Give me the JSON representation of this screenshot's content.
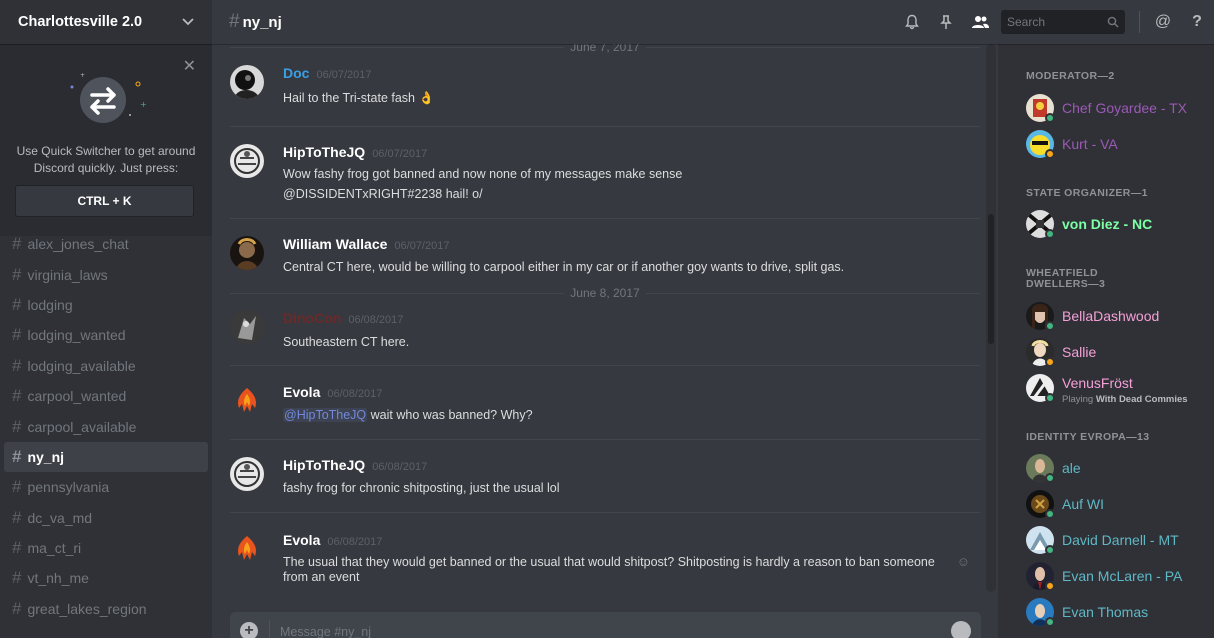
{
  "server": {
    "name": "Charlottesville 2.0"
  },
  "quick_switcher": {
    "text": "Use Quick Switcher to get around Discord quickly. Just press:",
    "shortcut": "CTRL + K"
  },
  "channels": [
    "alex_jones_chat",
    "virginia_laws",
    "lodging",
    "lodging_wanted",
    "lodging_available",
    "carpool_wanted",
    "carpool_available",
    "ny_nj",
    "pennsylvania",
    "dc_va_md",
    "ma_ct_ri",
    "vt_nh_me",
    "great_lakes_region"
  ],
  "active_channel": "ny_nj",
  "header": {
    "channel": "ny_nj",
    "search_placeholder": "Search"
  },
  "dividers": {
    "top": "June 7, 2017",
    "second": "June 8, 2017"
  },
  "messages": [
    {
      "author": "Doc",
      "color": "#3aa0e6",
      "date": "06/07/2017",
      "lines": [
        "Hail to the Tri-state fash 👌"
      ]
    },
    {
      "author": "HipToTheJQ",
      "color": "#ffffff",
      "date": "06/07/2017",
      "lines": [
        "Wow fashy frog got banned and now none of my messages make sense",
        "@DISSIDENTxRIGHT#2238 hail! o/"
      ]
    },
    {
      "author": "William Wallace",
      "color": "#ffffff",
      "date": "06/07/2017",
      "lines": [
        "Central CT here, would be willing to carpool either in my car or if another goy wants to drive, split gas."
      ]
    },
    {
      "author": "DinoCon",
      "color": "#6b2a2a",
      "date": "06/08/2017",
      "lines": [
        "Southeastern CT here."
      ]
    },
    {
      "author": "Evola",
      "color": "#ffffff",
      "date": "06/08/2017",
      "mention": "@HipToTheJQ",
      "lines": [
        "wait who was banned? Why?"
      ]
    },
    {
      "author": "HipToTheJQ",
      "color": "#ffffff",
      "date": "06/08/2017",
      "lines": [
        "fashy frog for chronic shitposting, just the usual lol"
      ]
    },
    {
      "author": "Evola",
      "color": "#ffffff",
      "date": "06/08/2017",
      "lines": [
        "The usual  that they would get banned or the usual that would shitpost? Shitposting is hardly a reason to ban someone",
        "from an event"
      ]
    }
  ],
  "composer": {
    "placeholder": "Message #ny_nj"
  },
  "members": {
    "groups": [
      {
        "title": "MODERATOR—2",
        "members": [
          {
            "name": "Chef Goyardee - TX",
            "color": "#9b59b6",
            "status": "#43b581"
          },
          {
            "name": "Kurt - VA",
            "color": "#9b59b6",
            "status": "#faa61a"
          }
        ]
      },
      {
        "title": "STATE ORGANIZER—1",
        "members": [
          {
            "name": "von Diez - NC",
            "color": "#7dffa6",
            "status": "#43b581"
          }
        ]
      },
      {
        "title": "WHEATFIELD DWELLERS—3",
        "members": [
          {
            "name": "BellaDashwood",
            "color": "#f5a0d8",
            "status": "#43b581"
          },
          {
            "name": "Sallie",
            "color": "#f5a0d8",
            "status": "#faa61a"
          },
          {
            "name": "VenusFröst",
            "color": "#f5a0d8",
            "status": "#43b581",
            "playing_prefix": "Playing",
            "playing_game": "With Dead Commies"
          }
        ]
      },
      {
        "title": "IDENTITY EVROPA—13",
        "members": [
          {
            "name": "ale",
            "color": "#5fb8c6",
            "status": "#43b581"
          },
          {
            "name": "Auf WI",
            "color": "#5fb8c6",
            "status": "#43b581"
          },
          {
            "name": "David Darnell - MT",
            "color": "#5fb8c6",
            "status": "#43b581"
          },
          {
            "name": "Evan McLaren - PA",
            "color": "#5fb8c6",
            "status": "#faa61a"
          },
          {
            "name": "Evan Thomas",
            "color": "#5fb8c6",
            "status": "#43b581"
          }
        ]
      }
    ]
  }
}
